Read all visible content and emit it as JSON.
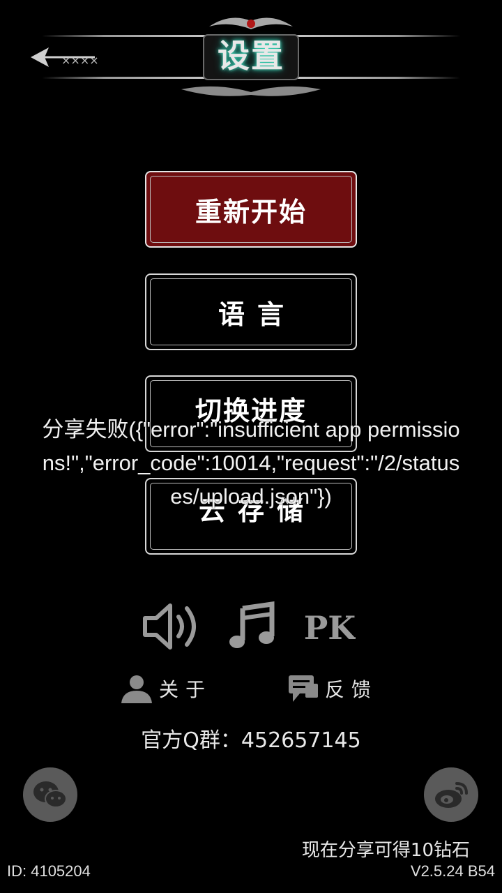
{
  "header": {
    "title": "设置",
    "back_icon": "back-arrow-icon"
  },
  "menu": [
    {
      "label": "重新开始"
    },
    {
      "label": "语言"
    },
    {
      "label": "切换进度"
    },
    {
      "label": "云存储"
    }
  ],
  "toast": {
    "text": "分享失败({\"error\":\"insufficient app permissions!\",\"error_code\":10014,\"request\":\"/2/statuses/upload.json\"})"
  },
  "toggles": {
    "sound_icon": "speaker-icon",
    "music_icon": "music-note-icon",
    "pk_icon": "pk-icon",
    "pk_label": "PK"
  },
  "links": {
    "about": "关于",
    "feedback": "反馈"
  },
  "qq_group": "官方Q群：452657145",
  "share": {
    "wechat_icon": "wechat-icon",
    "weibo_icon": "weibo-icon",
    "reward_text": "现在分享可得10钻石"
  },
  "footer": {
    "id": "ID: 4105204",
    "version": "V2.5.24 B54"
  },
  "colors": {
    "primary_button": "#6e0d0f",
    "background": "#000000",
    "title_glow": "#3fe0c0"
  }
}
